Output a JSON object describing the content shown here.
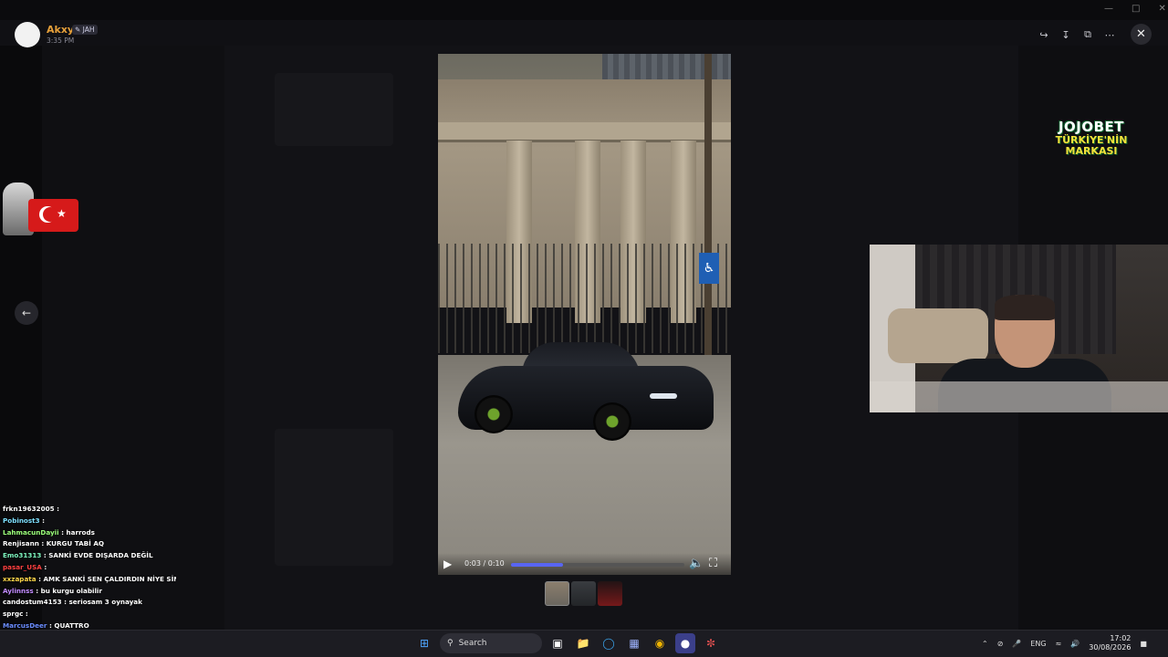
{
  "viewer": {
    "author": "Akxy",
    "badge": "JAH",
    "badge_icon": "brush-icon",
    "time": "3:35 PM",
    "actions": [
      "forward-icon",
      "download-icon",
      "open-external-icon",
      "more-icon"
    ],
    "close_icon": "close-icon"
  },
  "video": {
    "time_display": "0:03 / 0:10",
    "progress": 0.3,
    "accent": "#5865f2"
  },
  "sponsor": {
    "line1": "JOJOBET",
    "line2": "TÜRKİYE'NİN",
    "line3": "MARKASI"
  },
  "chat": [
    {
      "user": "frkn19632005",
      "color": "#ffffff",
      "text": ":"
    },
    {
      "user": "Pobinost3",
      "color": "#7ee0ff",
      "text": ":"
    },
    {
      "user": "LahmacunDayii",
      "color": "#9bff7a",
      "text": ": harrods"
    },
    {
      "user": "Renjisann",
      "color": "#ffffff",
      "text": ": KURGU TABİ AQ"
    },
    {
      "user": "Emo31313",
      "color": "#7ef7c0",
      "text": ": SANKİ EVDE DIŞARDA DEĞİL"
    },
    {
      "user": "pasar_USA",
      "color": "#ff4040",
      "text": ":"
    },
    {
      "user": "xxzapata",
      "color": "#ffd84a",
      "text": ": AMK SANKİ SEN ÇALDIRDIN NİYE SİNİRLENİYON"
    },
    {
      "user": "Aylinnss",
      "color": "#c28cff",
      "text": ": bu kurgu olabilir"
    },
    {
      "user": "candostum4153",
      "color": "#ffffff",
      "text": ": seriosam 3 oynayak"
    },
    {
      "user": "sprgc",
      "color": "#ffffff",
      "text": ":"
    },
    {
      "user": "MarcusDeer",
      "color": "#6a8cff",
      "text": ": QUATTRO"
    }
  ],
  "taskbar": {
    "search_label": "Search",
    "lang": "ENG",
    "time": "17:02",
    "date": "30/08/2026"
  }
}
